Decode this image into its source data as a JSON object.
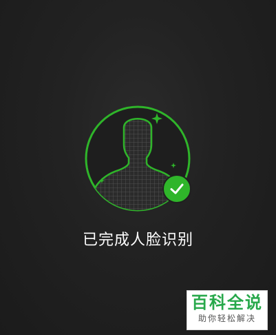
{
  "status": {
    "message": "已完成人脸识别"
  },
  "watermark": {
    "title": "百科全说",
    "subtitle": "助你轻松解决"
  },
  "icons": {
    "face": "face-silhouette-icon",
    "check": "checkmark-icon",
    "sparkle": "sparkle-icon"
  },
  "colors": {
    "accent": "#2fb52a",
    "background": "#222222",
    "text": "#ffffff",
    "watermark_green": "#27a84a"
  }
}
